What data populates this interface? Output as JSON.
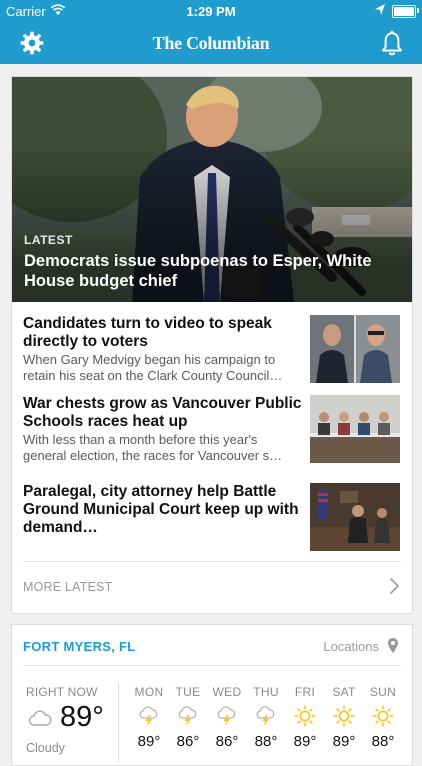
{
  "status_bar": {
    "carrier": "Carrier",
    "time": "1:29 PM"
  },
  "nav": {
    "title": "The Columbian",
    "settings_icon": "gear-icon",
    "notifications_icon": "bell-icon"
  },
  "hero": {
    "kicker": "LATEST",
    "headline": "Democrats issue subpoenas to Esper, White House budget chief"
  },
  "stories": [
    {
      "headline": "Candidates turn to video to speak directly to voters",
      "dek": "When Gary Medvigy began his campaign to retain his seat on the Clark County Council…"
    },
    {
      "headline": "War chests grow as Vancouver Public Schools races heat up",
      "dek": "With less than a month before this year's general election, the races for Vancouver s…"
    },
    {
      "headline": "Paralegal, city attorney help Battle Ground Municipal Court keep up with demand…",
      "dek": ""
    }
  ],
  "more": {
    "label": "MORE LATEST"
  },
  "weather": {
    "city": "FORT MYERS, FL",
    "locations_label": "Locations",
    "now": {
      "label": "RIGHT NOW",
      "temp": "89°",
      "condition": "Cloudy"
    },
    "days": [
      {
        "name": "MON",
        "temp": "89°",
        "icon": "thunderstorm-icon"
      },
      {
        "name": "TUE",
        "temp": "86°",
        "icon": "thunderstorm-icon"
      },
      {
        "name": "WED",
        "temp": "86°",
        "icon": "thunderstorm-icon"
      },
      {
        "name": "THU",
        "temp": "88°",
        "icon": "thunderstorm-icon"
      },
      {
        "name": "FRI",
        "temp": "89°",
        "icon": "sun-icon"
      },
      {
        "name": "SAT",
        "temp": "89°",
        "icon": "sun-icon"
      },
      {
        "name": "SUN",
        "temp": "88°",
        "icon": "sun-icon"
      }
    ]
  },
  "colors": {
    "brand": "#1f9bcd",
    "sun": "#f5c518"
  }
}
